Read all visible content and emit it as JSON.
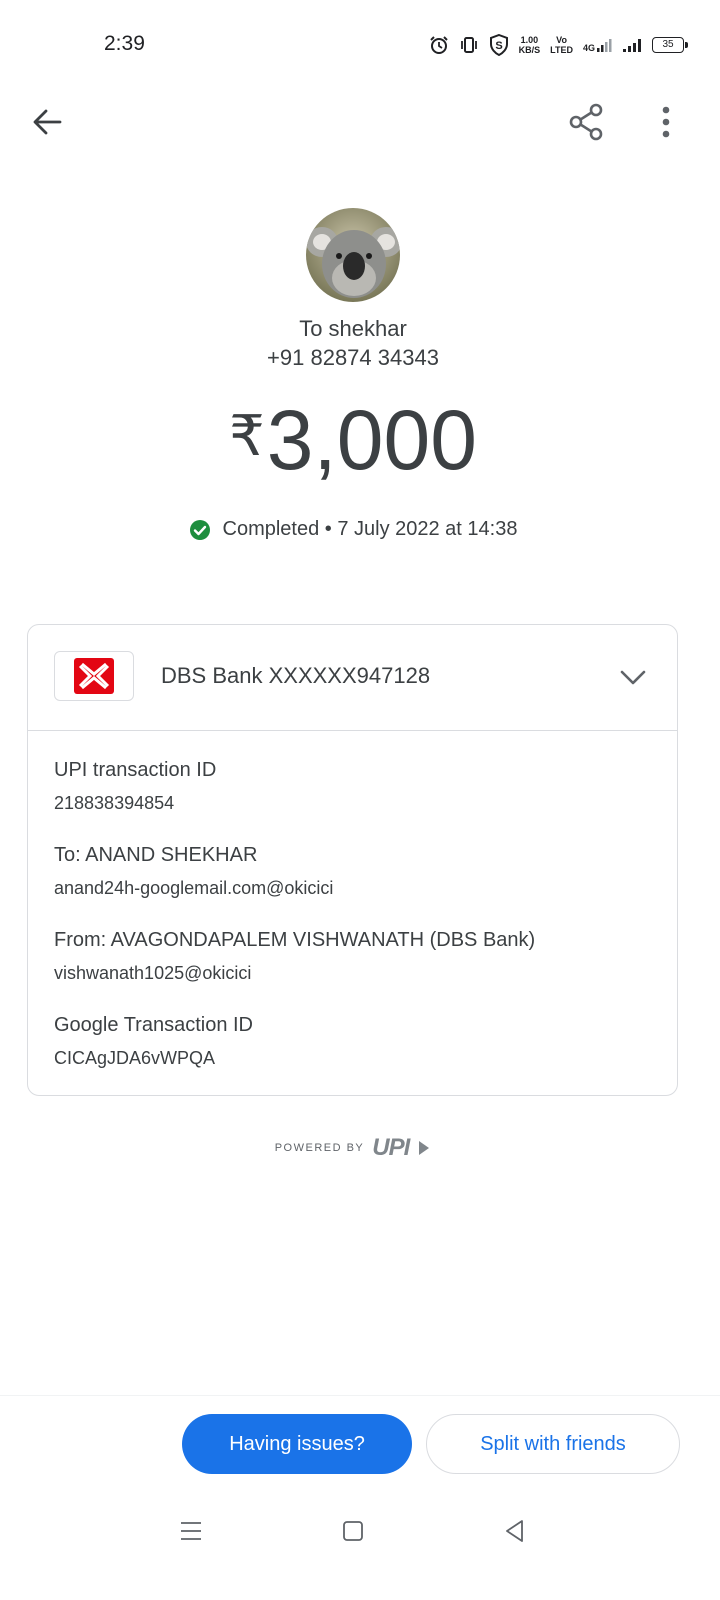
{
  "status_bar": {
    "time": "2:39",
    "speed_value": "1.00",
    "speed_unit": "KB/S",
    "volte_top": "Vo",
    "volte_bottom": "LTED",
    "network": "4G",
    "battery": "35"
  },
  "app_bar": {
    "back_icon": "arrow-left-icon",
    "share_icon": "share-icon",
    "more_icon": "more-vert-icon"
  },
  "recipient": {
    "name": "To shekhar",
    "phone": "+91 82874 34343"
  },
  "amount": {
    "currency": "₹",
    "value": "3,000"
  },
  "status": {
    "text": "Completed • 7 July 2022 at 14:38",
    "color": "#1e8e3e"
  },
  "bank": {
    "name": "DBS Bank XXXXXX947128",
    "logo_color": "#e30613"
  },
  "details": [
    {
      "label": "UPI transaction ID",
      "value": "218838394854"
    },
    {
      "label": "To: ANAND SHEKHAR",
      "value": "anand24h-googlemail.com@okicici"
    },
    {
      "label": "From: AVAGONDAPALEM VISHWANATH (DBS Bank)",
      "value": "vishwanath1025@okicici"
    },
    {
      "label": "Google Transaction ID",
      "value": "CICAgJDA6vWPQA"
    }
  ],
  "powered_by": {
    "text": "POWERED BY",
    "logo": "UPI"
  },
  "buttons": {
    "issues": "Having issues?",
    "split": "Split with friends"
  },
  "colors": {
    "accent": "#1a73e8",
    "text": "#3c4043",
    "border": "#dadce0"
  }
}
